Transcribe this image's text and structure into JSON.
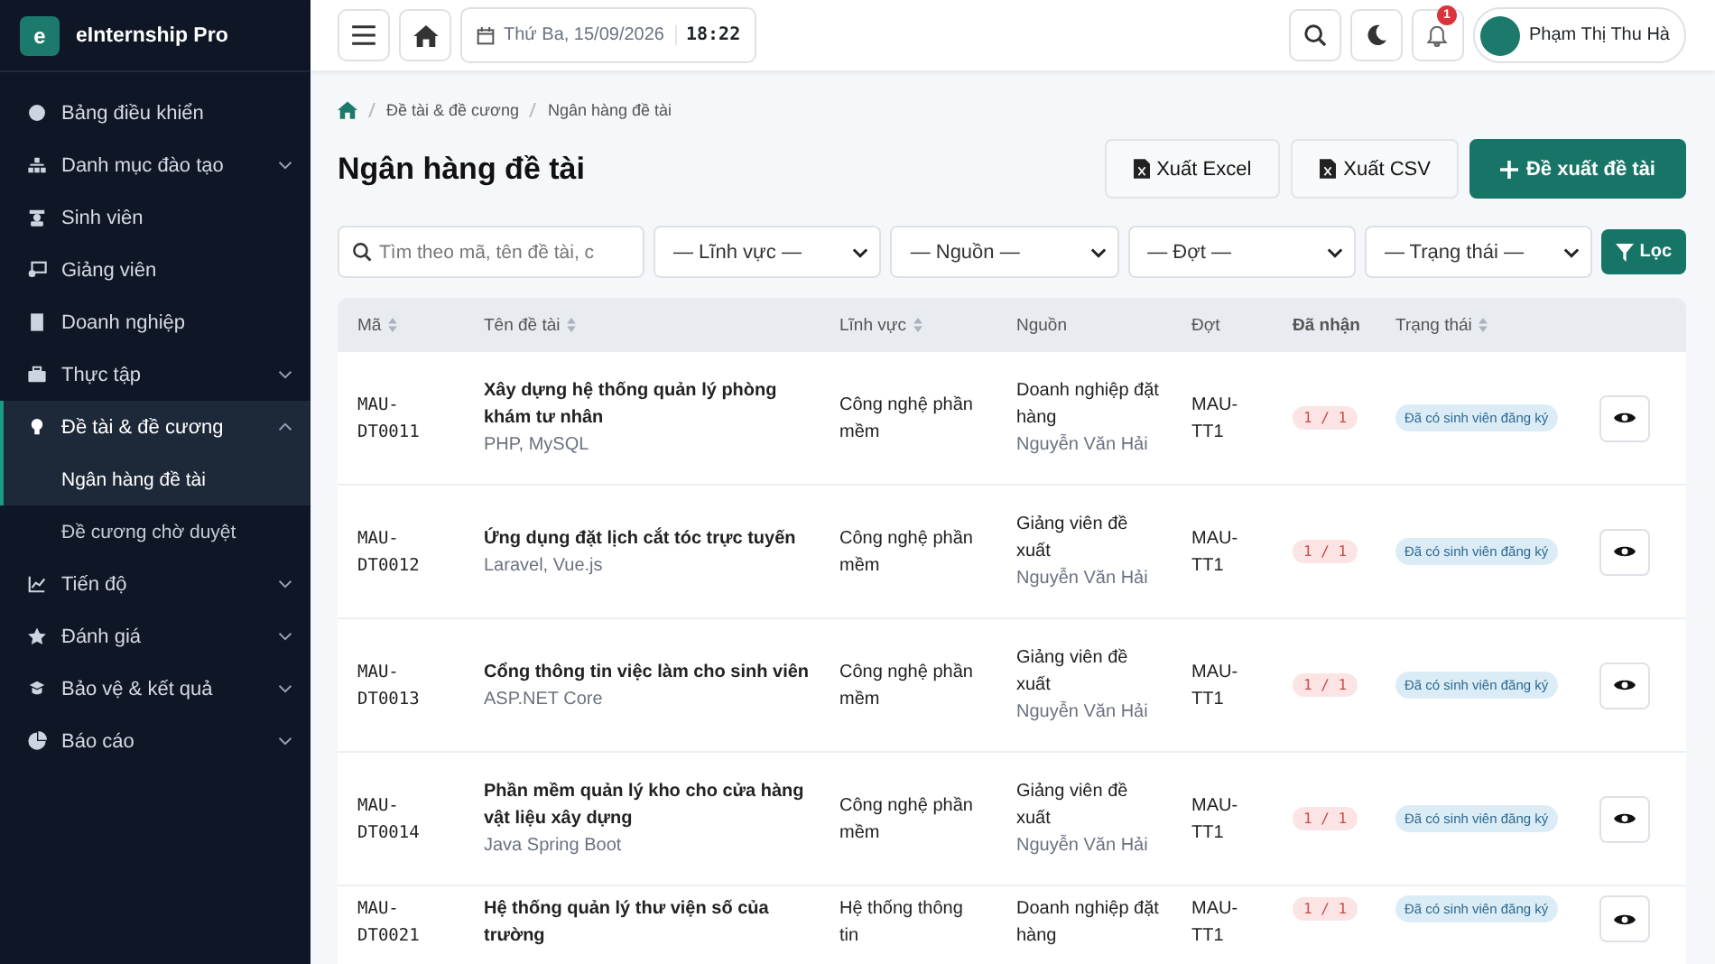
{
  "app": {
    "logo_letter": "e",
    "name": "eInternship Pro"
  },
  "sidebar": {
    "items": [
      {
        "label": "Bảng điều khiển"
      },
      {
        "label": "Danh mục đào tạo",
        "expanded": false
      },
      {
        "label": "Sinh viên"
      },
      {
        "label": "Giảng viên"
      },
      {
        "label": "Doanh nghiệp"
      },
      {
        "label": "Thực tập",
        "expanded": false
      },
      {
        "label": "Đề tài & đề cương",
        "expanded": true,
        "children": [
          {
            "label": "Ngân hàng đề tài",
            "selected": true
          },
          {
            "label": "Đề cương chờ duyệt",
            "selected": false
          }
        ]
      },
      {
        "label": "Tiến độ",
        "expanded": false
      },
      {
        "label": "Đánh giá",
        "expanded": false
      },
      {
        "label": "Bảo vệ & kết quả",
        "expanded": false
      },
      {
        "label": "Báo cáo",
        "expanded": false
      }
    ]
  },
  "topbar": {
    "date": "Thứ Ba, 15/09/2026",
    "time": "18:22",
    "notification_count": "1",
    "user_name": "Phạm Thị Thu Hà"
  },
  "breadcrumb": [
    "Đề tài & đề cương",
    "Ngân hàng đề tài"
  ],
  "page_title": "Ngân hàng đề tài",
  "actions": [
    {
      "label": "Xuất Excel",
      "kind": "excel"
    },
    {
      "label": "Xuất CSV",
      "kind": "csv"
    },
    {
      "label": "Đề xuất đề tài",
      "kind": "primary"
    }
  ],
  "filters": {
    "search_placeholder": "Tìm theo mã, tên đề tài, c",
    "selects": [
      "— Lĩnh vực —",
      "— Nguồn —",
      "— Đợt —",
      "— Trạng thái —"
    ],
    "button": "Lọc"
  },
  "table": {
    "columns": [
      {
        "label": "Mã",
        "sortable": true
      },
      {
        "label": "Tên đề tài",
        "sortable": true
      },
      {
        "label": "Lĩnh vực",
        "sortable": true
      },
      {
        "label": "Nguồn",
        "sortable": false
      },
      {
        "label": "Đợt",
        "sortable": false
      },
      {
        "label": "Đã nhận",
        "sortable": false
      },
      {
        "label": "Trạng thái",
        "sortable": true
      }
    ],
    "rows": [
      {
        "code": "MAU-DT0011",
        "title": "Xây dựng hệ thống quản lý phòng khám tư nhân",
        "tech": "PHP, MySQL",
        "field": "Công nghệ phần mềm",
        "source": "Doanh nghiệp đặt hàng",
        "lecturer": "Nguyễn Văn Hải",
        "batch": "MAU-TT1",
        "received": "1 / 1",
        "status": "Đã có sinh viên đăng ký"
      },
      {
        "code": "MAU-DT0012",
        "title": "Ứng dụng đặt lịch cắt tóc trực tuyến",
        "tech": "Laravel, Vue.js",
        "field": "Công nghệ phần mềm",
        "source": "Giảng viên đề xuất",
        "lecturer": "Nguyễn Văn Hải",
        "batch": "MAU-TT1",
        "received": "1 / 1",
        "status": "Đã có sinh viên đăng ký"
      },
      {
        "code": "MAU-DT0013",
        "title": "Cổng thông tin việc làm cho sinh viên",
        "tech": "ASP.NET Core",
        "field": "Công nghệ phần mềm",
        "source": "Giảng viên đề xuất",
        "lecturer": "Nguyễn Văn Hải",
        "batch": "MAU-TT1",
        "received": "1 / 1",
        "status": "Đã có sinh viên đăng ký"
      },
      {
        "code": "MAU-DT0014",
        "title": "Phần mềm quản lý kho cho cửa hàng vật liệu xây dựng",
        "tech": "Java Spring Boot",
        "field": "Công nghệ phần mềm",
        "source": "Giảng viên đề xuất",
        "lecturer": "Nguyễn Văn Hải",
        "batch": "MAU-TT1",
        "received": "1 / 1",
        "status": "Đã có sinh viên đăng ký"
      },
      {
        "code": "MAU-DT0021",
        "title": "Hệ thống quản lý thư viện số của trường",
        "field": "Hệ thống thông tin",
        "source": "Doanh nghiệp đặt hàng",
        "batch": "MAU-TT1",
        "received": "1 / 1",
        "status": "Đã có sinh viên đăng ký"
      }
    ]
  }
}
